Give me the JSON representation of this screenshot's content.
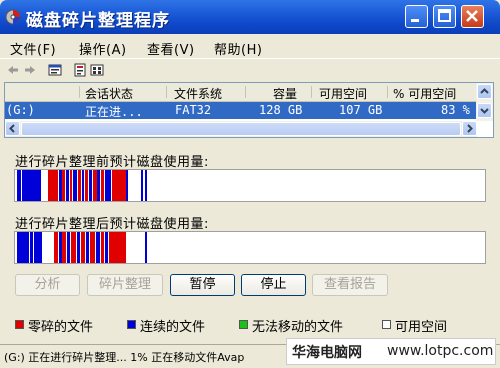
{
  "window": {
    "title": "磁盘碎片整理程序"
  },
  "menu": [
    "文件(F)",
    "操作(A)",
    "查看(V)",
    "帮助(H)"
  ],
  "toolbar": {
    "icons": [
      "back-arrow-icon",
      "forward-arrow-icon",
      "properties-icon",
      "help-icon",
      "view-icon"
    ]
  },
  "volumes": {
    "headers": [
      "会话状态",
      "文件系统",
      "容量",
      "可用空间",
      "% 可用空间"
    ],
    "rows": [
      {
        "volume": "(G:)",
        "status": "正在进...",
        "fs": "FAT32",
        "capacity": "128 GB",
        "free": "107 GB",
        "pct": "83 %"
      }
    ]
  },
  "analysis": {
    "before_label": "进行碎片整理前预计磁盘使用量:",
    "after_label": "进行碎片整理后预计磁盘使用量:"
  },
  "buttons": {
    "analyze": "分析",
    "defrag": "碎片整理",
    "pause": "暂停",
    "stop": "停止",
    "report": "查看报告"
  },
  "legend": [
    {
      "label": "零碎的文件",
      "color": "#e00000"
    },
    {
      "label": "连续的文件",
      "color": "#0000d8"
    },
    {
      "label": "无法移动的文件",
      "color": "#18c018"
    },
    {
      "label": "可用空间",
      "color": "#ffffff"
    }
  ],
  "status": {
    "text": "(G:) 正在进行碎片整理... 1%  正在移动文件Avap",
    "watermark_a": "华海电脑网",
    "watermark_b": "www.lotpc.com"
  },
  "colors": {
    "fragmented": "#e00000",
    "contiguous": "#0000d8",
    "unmovable": "#18c018",
    "free": "#ffffff",
    "titlebar": "#0d46c7",
    "selection": "#316ac5"
  }
}
